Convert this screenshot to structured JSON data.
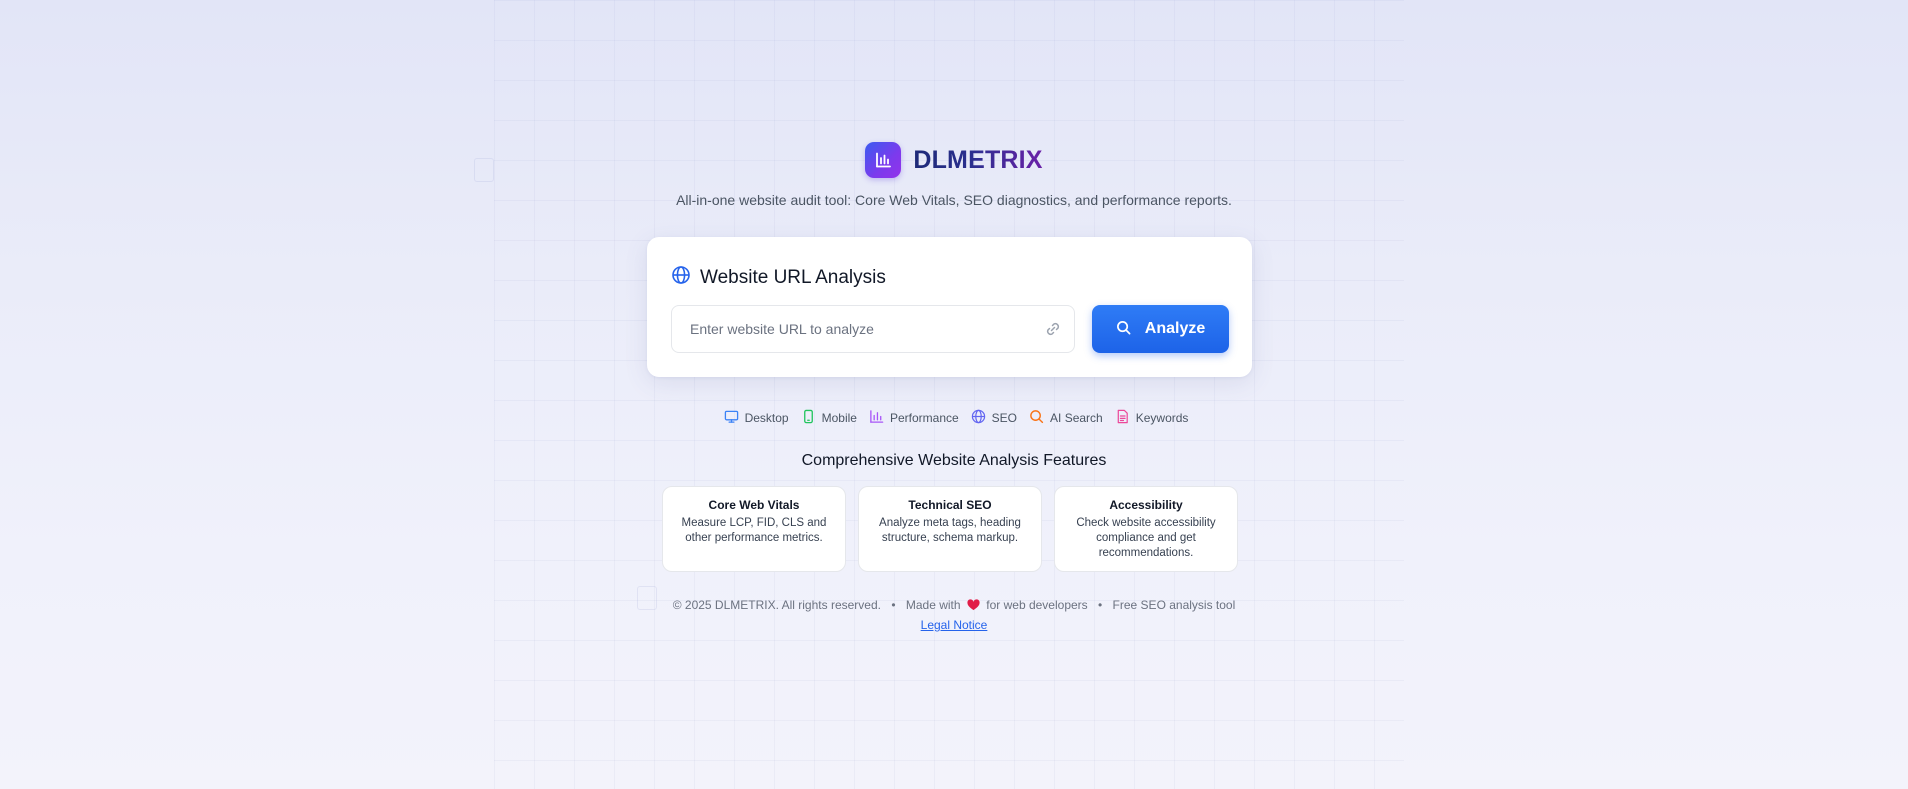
{
  "brand": {
    "name": "DLMETRIX",
    "tagline": "All-in-one website audit tool: Core Web Vitals, SEO diagnostics, and performance reports."
  },
  "analysis_card": {
    "title": "Website URL Analysis",
    "title_icon": "globe-icon",
    "url_input": {
      "placeholder": "Enter website URL to analyze",
      "value": ""
    },
    "input_icon": "link-icon",
    "analyze_button": {
      "label": "Analyze",
      "icon": "search-icon"
    }
  },
  "categories": [
    {
      "label": "Desktop",
      "icon": "monitor-icon",
      "color": "#3b82f6"
    },
    {
      "label": "Mobile",
      "icon": "smartphone-icon",
      "color": "#22c55e"
    },
    {
      "label": "Performance",
      "icon": "bar-chart-icon",
      "color": "#a855f7"
    },
    {
      "label": "SEO",
      "icon": "globe-icon",
      "color": "#6366f1"
    },
    {
      "label": "AI Search",
      "icon": "search-icon",
      "color": "#f97316"
    },
    {
      "label": "Keywords",
      "icon": "document-icon",
      "color": "#ec4899"
    }
  ],
  "features": {
    "title": "Comprehensive Website Analysis Features",
    "items": [
      {
        "title": "Core Web Vitals",
        "description": "Measure LCP, FID, CLS and other performance metrics."
      },
      {
        "title": "Technical SEO",
        "description": "Analyze meta tags, heading structure, schema markup."
      },
      {
        "title": "Accessibility",
        "description": "Check website accessibility compliance and get recommendations."
      }
    ]
  },
  "footer": {
    "copyright": "© 2025 DLMETRIX. All rights reserved.",
    "separator": "•",
    "made_with_prefix": "Made with",
    "made_with_suffix": "for web developers",
    "heart_icon": "heart-icon",
    "tool_note": "Free SEO analysis tool",
    "legal_link": "Legal Notice"
  },
  "colors": {
    "accent": "#2563eb",
    "brand_gradient_start": "#3b5bf0",
    "brand_gradient_end": "#9333ea",
    "heart": "#e11d48"
  }
}
